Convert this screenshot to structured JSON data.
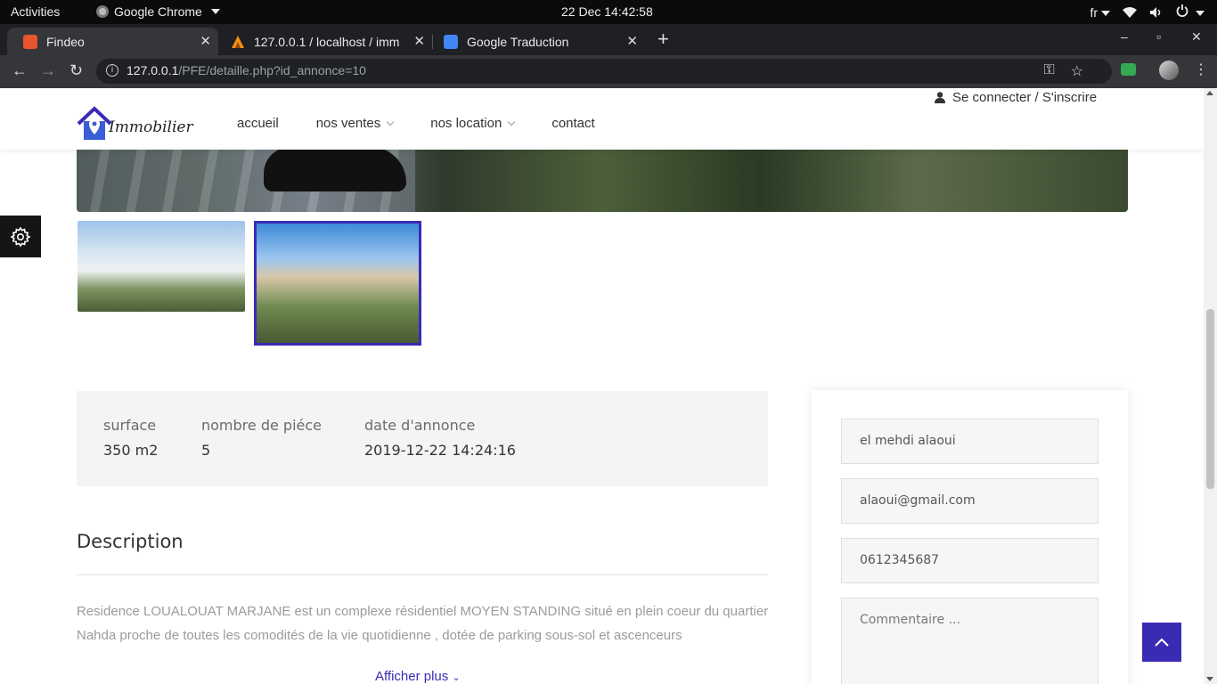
{
  "system_bar": {
    "activities": "Activities",
    "app_name": "Google Chrome",
    "clock": "22 Dec  14:42:58",
    "keyboard_layout": "fr"
  },
  "browser": {
    "tabs": [
      {
        "title": "Findeo",
        "active": true,
        "favicon_color": "#e8542b"
      },
      {
        "title": "127.0.0.1 / localhost / imm",
        "active": false,
        "favicon_color": "#f29111"
      },
      {
        "title": "Google Traduction",
        "active": false,
        "favicon_color": "#4285f4"
      }
    ],
    "url_host": "127.0.0.1",
    "url_path": "/PFE/detaille.php?id_annonce=10"
  },
  "site": {
    "logo_text": "Immobilier",
    "nav": [
      {
        "label": "accueil",
        "dropdown": false
      },
      {
        "label": "nos ventes",
        "dropdown": true
      },
      {
        "label": "nos location",
        "dropdown": true
      },
      {
        "label": "contact",
        "dropdown": false
      }
    ],
    "login_label": "Se connecter / S'inscrire",
    "accent_color": "#3a2bb5"
  },
  "property": {
    "facts": [
      {
        "label": "surface",
        "value": "350 m2"
      },
      {
        "label": "nombre de piéce",
        "value": "5"
      },
      {
        "label": "date d'annonce",
        "value": "2019-12-22 14:24:16"
      }
    ],
    "description_title": "Description",
    "description_text": "Residence LOUALOUAT MARJANE est un complexe résidentiel MOYEN STANDING situé en plein coeur du quartier Nahda proche de toutes les comodités de la vie quotidienne , dotée de parking sous-sol et ascenceurs",
    "show_more": "Afficher plus"
  },
  "contact_form": {
    "name": "el mehdi alaoui",
    "email": "alaoui@gmail.com",
    "phone": "0612345687",
    "comment_placeholder": "Commentaire ..."
  }
}
